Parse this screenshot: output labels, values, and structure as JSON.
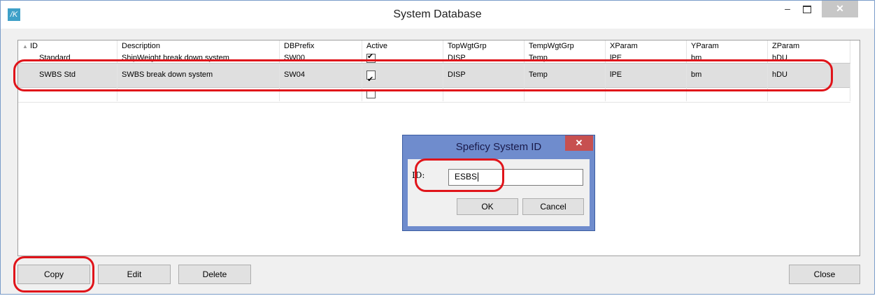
{
  "window": {
    "title": "System Database",
    "app_icon_glyph": "/K",
    "minimize_glyph": "–",
    "close_glyph": "✕"
  },
  "grid": {
    "columns": [
      "ID",
      "Description",
      "DBPrefix",
      "Active",
      "TopWgtGrp",
      "TempWgtGrp",
      "XParam",
      "YParam",
      "ZParam"
    ],
    "sort_indicator": "▲",
    "rows": [
      {
        "id": "Standard",
        "description": "ShipWeight break down system",
        "dbprefix": "SW00",
        "active": true,
        "topwgtgrp": "DISP",
        "tempwgtgrp": "Temp",
        "xparam": "lPE",
        "yparam": "bm",
        "zparam": "hDU"
      },
      {
        "id": "SWBS Std",
        "description": "SWBS break down system",
        "dbprefix": "SW04",
        "active": true,
        "topwgtgrp": "DISP",
        "tempwgtgrp": "Temp",
        "xparam": "lPE",
        "yparam": "bm",
        "zparam": "hDU"
      },
      {
        "id": "",
        "description": "",
        "dbprefix": "",
        "active": false,
        "topwgtgrp": "",
        "tempwgtgrp": "",
        "xparam": "",
        "yparam": "",
        "zparam": ""
      }
    ]
  },
  "dialog": {
    "title": "Speficy System ID",
    "label": "ID:",
    "value": "ESBS",
    "ok": "OK",
    "cancel": "Cancel",
    "close_glyph": "✕"
  },
  "buttons": {
    "copy": "Copy",
    "edit": "Edit",
    "delete": "Delete",
    "close": "Close"
  },
  "colors": {
    "annotation": "#e0141a",
    "dialog_frame": "#6f8ccd",
    "selected_row": "#dfdfdf"
  }
}
